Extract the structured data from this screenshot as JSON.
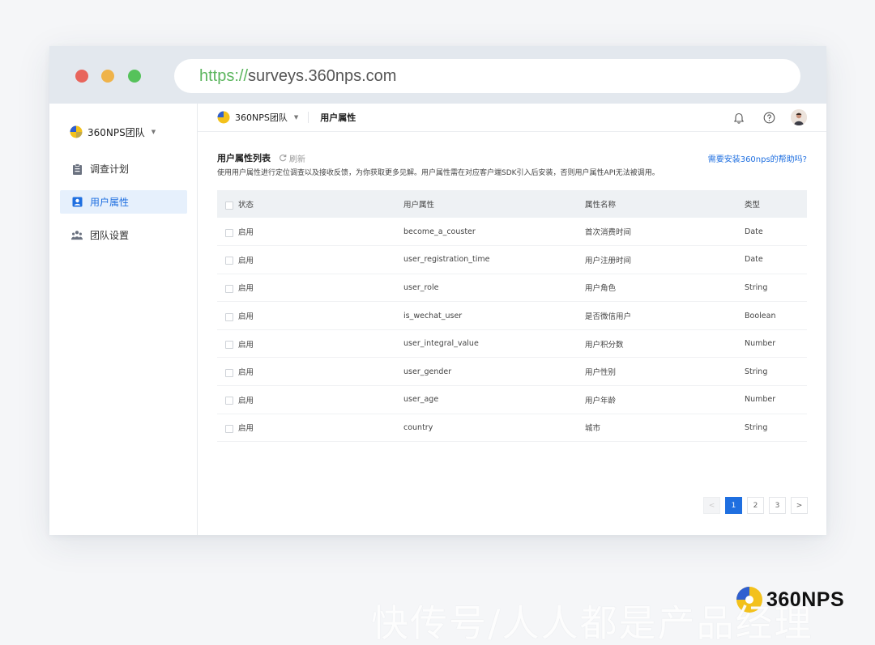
{
  "browser": {
    "url_scheme": "https://",
    "url_rest": "surveys.360nps.com"
  },
  "sidebar": {
    "team_name": "360NPS团队",
    "items": [
      {
        "label": "调查计划",
        "icon": "clipboard-icon"
      },
      {
        "label": "用户属性",
        "icon": "user-card-icon",
        "active": true
      },
      {
        "label": "团队设置",
        "icon": "team-icon"
      }
    ]
  },
  "topbar": {
    "team_name": "360NPS团队",
    "breadcrumb": "用户属性"
  },
  "main": {
    "title": "用户属性列表",
    "refresh_label": "刷新",
    "help_link": "需要安装360nps的帮助吗?",
    "description": "使用用户属性进行定位调查以及接收反馈，为你获取更多见解。用户属性需在对应客户端SDK引入后安装，否则用户属性API无法被调用。"
  },
  "table": {
    "headers": [
      "状态",
      "用户属性",
      "属性名称",
      "类型"
    ],
    "rows": [
      {
        "status": "启用",
        "key": "become_a_couster",
        "name": "首次消费时间",
        "type": "Date"
      },
      {
        "status": "启用",
        "key": "user_registration_time",
        "name": "用户注册时间",
        "type": "Date"
      },
      {
        "status": "启用",
        "key": "user_role",
        "name": "用户角色",
        "type": "String"
      },
      {
        "status": "启用",
        "key": "is_wechat_user",
        "name": "是否微信用户",
        "type": "Boolean"
      },
      {
        "status": "启用",
        "key": "user_integral_value",
        "name": "用户积分数",
        "type": "Number"
      },
      {
        "status": "启用",
        "key": "user_gender",
        "name": "用户性别",
        "type": "String"
      },
      {
        "status": "启用",
        "key": "user_age",
        "name": "用户年龄",
        "type": "Number"
      },
      {
        "status": "启用",
        "key": "country",
        "name": "城市",
        "type": "String"
      }
    ]
  },
  "pagination": {
    "prev": "<",
    "pages": [
      "1",
      "2",
      "3"
    ],
    "current": "1",
    "next": ">"
  },
  "brand": {
    "name": "360NPS"
  },
  "watermark": "快传号/人人都是产品经理",
  "colors": {
    "accent": "#1f6fe0",
    "url_scheme": "#5bb55d",
    "logo_blue": "#2f5fd0",
    "logo_yellow": "#f3c11b"
  }
}
